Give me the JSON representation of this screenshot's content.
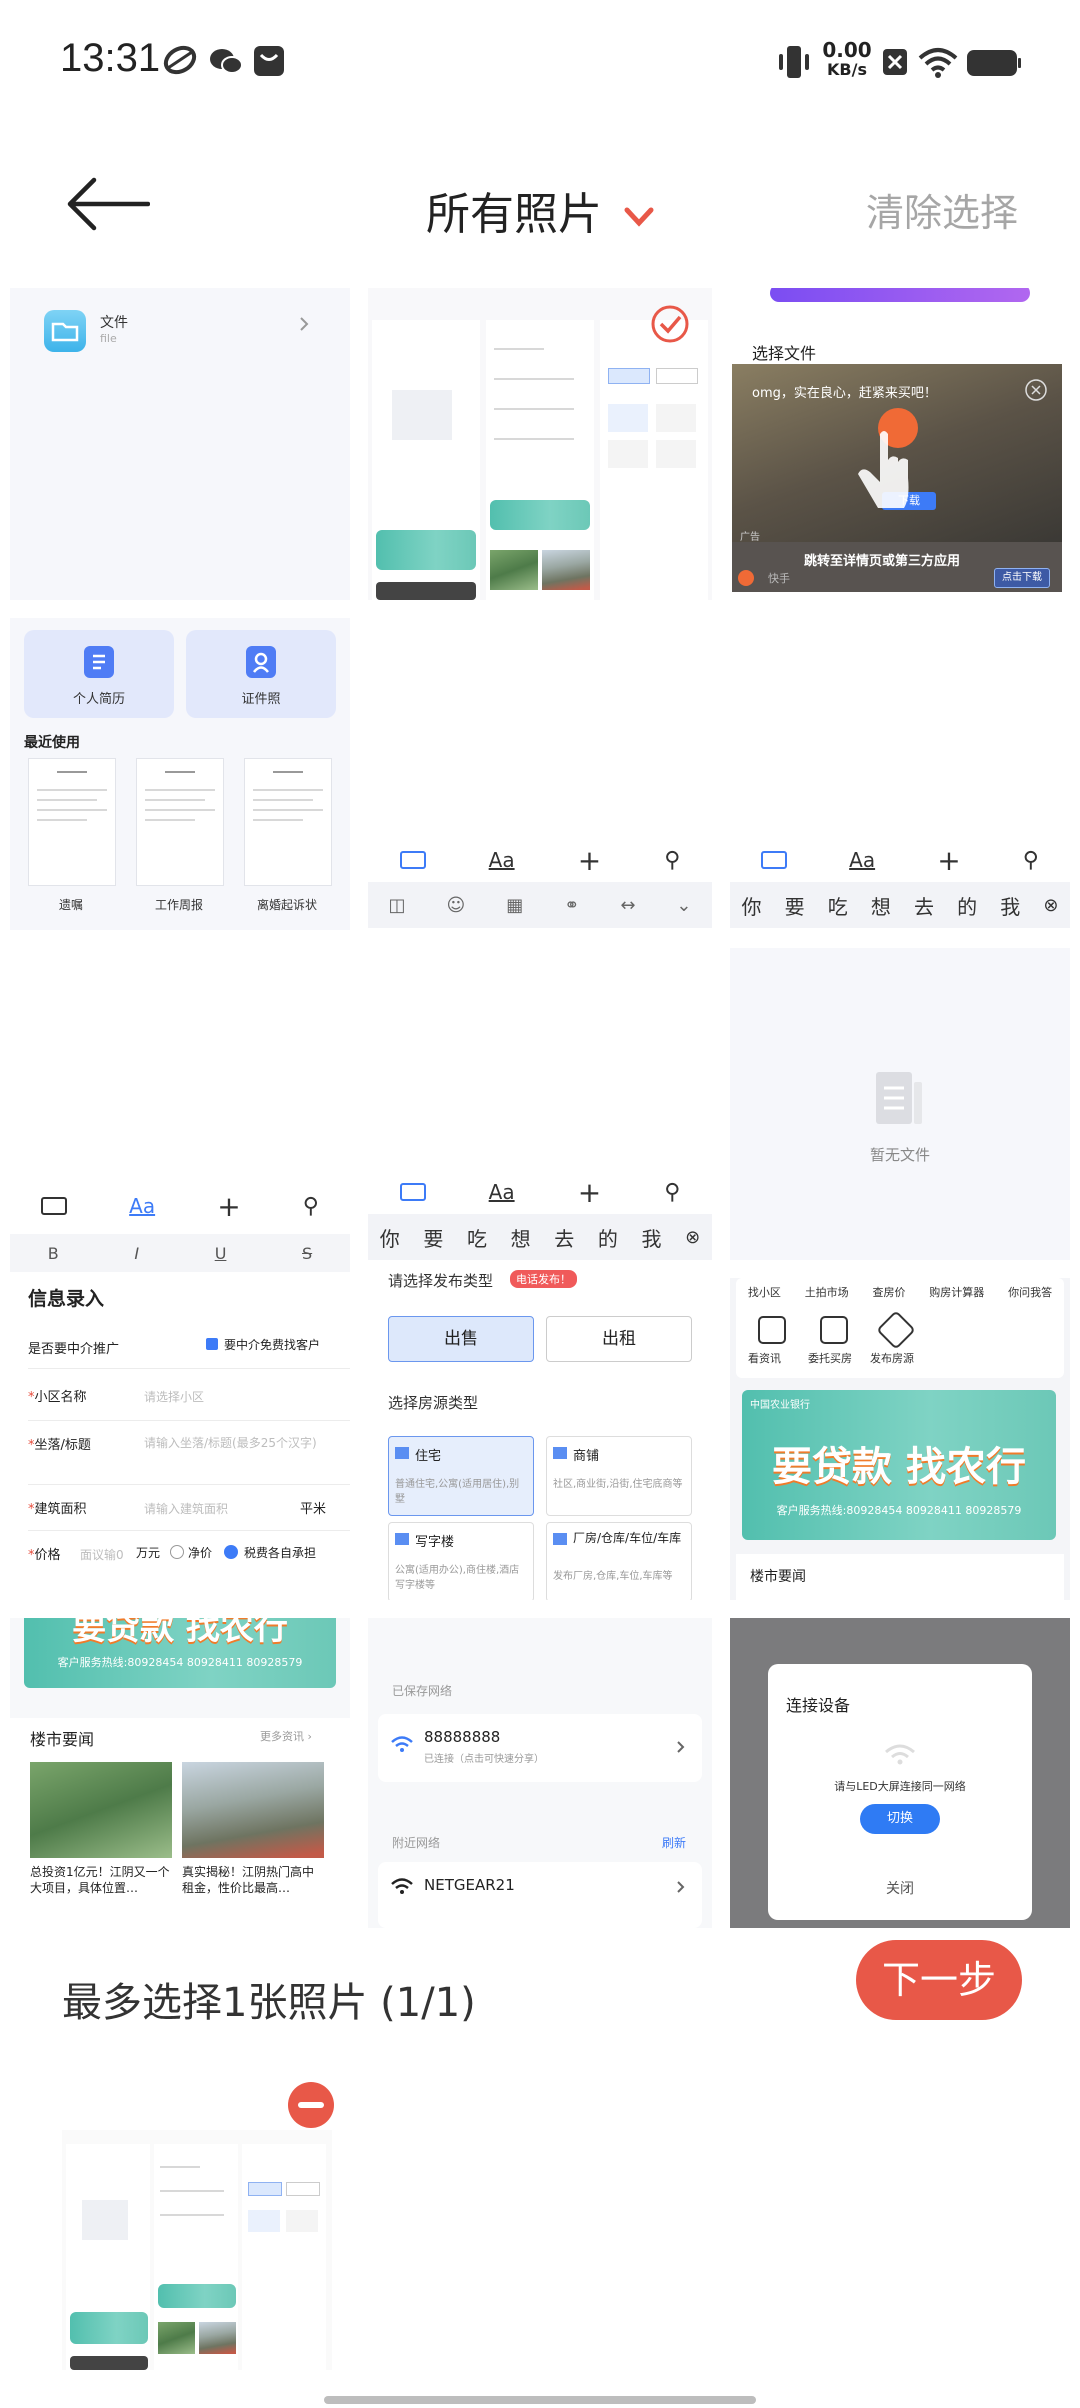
{
  "status_bar": {
    "time": "13:31",
    "net_speed_value": "0.00",
    "net_speed_unit": "KB/s",
    "icons": [
      "leaf-icon",
      "wechat-icon",
      "bag-icon",
      "vibrate-icon",
      "sim-off-icon",
      "wifi-icon",
      "battery-icon"
    ]
  },
  "header": {
    "title": "所有照片",
    "clear": "清除选择"
  },
  "tiles": {
    "t1": {
      "label": "文件",
      "sub": "file"
    },
    "t3": {
      "title": "选择文件",
      "ad_text": "omg，实在良心，赶紧来买吧！",
      "ad_btn": "下载",
      "ad_jump": "跳转至详情页或第三方应用",
      "ad_tag": "广告",
      "ad_user": "快手",
      "ad_click": "点击下载"
    },
    "t4": {
      "btn1": "个人简历",
      "btn2": "证件照",
      "recent": "最近使用",
      "docs": [
        "遗嘱",
        "工作周报",
        "离婚起诉状"
      ]
    },
    "t5": {
      "kb_aa": "Aa"
    },
    "t6": {
      "kb_aa": "Aa",
      "candidates": [
        "你",
        "要",
        "吃",
        "想",
        "去",
        "的",
        "我"
      ]
    },
    "t7": {
      "empty": "暂无文件"
    },
    "t8": {
      "kb_aa": "Aa",
      "fmt": [
        "B",
        "I",
        "U",
        "S"
      ],
      "title": "信息录入",
      "agent_q": "是否要中介推广",
      "agent_check": "要中介免费找客户",
      "f1": "小区名称",
      "f1_ph": "请选择小区",
      "f2": "坐落/标题",
      "f2_ph": "请输入坐落/标题(最多25个汉字)",
      "f3": "建筑面积",
      "f3_ph": "请输入建筑面积",
      "f3_unit": "平米",
      "f4": "价格",
      "f4_ph": "面议输0",
      "f4_unit": "万元",
      "f4_opt1": "净价",
      "f4_opt2": "税费各自承担"
    },
    "t9": {
      "kb_aa": "Aa",
      "candidates": [
        "你",
        "要",
        "吃",
        "想",
        "去",
        "的",
        "我"
      ],
      "choose": "请选择发布类型",
      "badge": "电话发布！",
      "sell": "出售",
      "rent": "出租",
      "choose_type": "选择房源类型",
      "types": [
        {
          "name": "住宅",
          "desc": "普通住宅,公寓(适用居住),别墅"
        },
        {
          "name": "商铺",
          "desc": "社区,商业街,沿街,住宅底商等"
        },
        {
          "name": "写字楼",
          "desc": "公寓(适用办公),商住楼,酒店写字楼等"
        },
        {
          "name": "厂房/仓库/车位/车库",
          "desc": "发布厂房,仓库,车位,车库等"
        }
      ]
    },
    "t10": {
      "nav": [
        "找小区",
        "土拍市场",
        "查房价",
        "购房计算器",
        "你问我答"
      ],
      "nav2": [
        "看资讯",
        "委托买房",
        "发布房源"
      ],
      "bank_name": "中国农业银行",
      "banner_main": "要贷款 找农行",
      "banner_sub": "客户服务热线:80928454 80928411 80928579",
      "news": "楼市要闻"
    },
    "t11": {
      "banner_main": "要贷款 找农行",
      "banner_sub": "客户服务热线:80928454 80928411 80928579",
      "news": "楼市要闻",
      "more": "更多资讯",
      "n1": "总投资1亿元！江阴又一个大项目，具体位置…",
      "n2": "真实揭秘！江阴热门高中租金，性价比最高…"
    },
    "t12": {
      "saved": "已保存网络",
      "wifi1": "88888888",
      "wifi1_sub": "已连接（点击可快速分享）",
      "nearby": "附近网络",
      "refresh": "刷新",
      "wifi2": "NETGEAR21"
    },
    "t13": {
      "title": "连接设备",
      "msg": "请与LED大屏连接同一网络",
      "switch": "切换",
      "close": "关闭"
    }
  },
  "bottom": {
    "label": "最多选择1张照片 (1/1)",
    "next": "下一步"
  },
  "colors": {
    "accent_red": "#e85848",
    "clear_gray": "#a6a6a6",
    "blue": "#3d7bf7",
    "banner_green": "#52bfae"
  }
}
